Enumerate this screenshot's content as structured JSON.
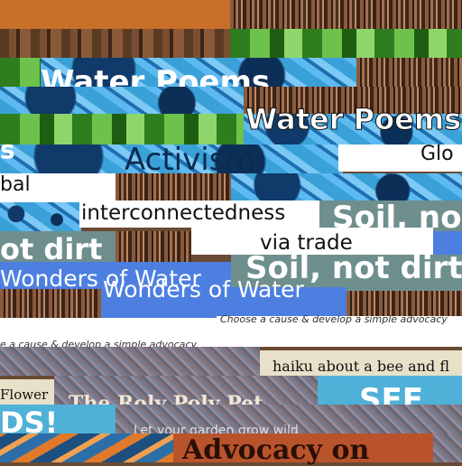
{
  "texts": {
    "water_poems_top": "Water Poems",
    "water_poems_right": "Water Poems",
    "activism": "Activism",
    "glo": "Glo",
    "bal": "bal",
    "s_left": "s",
    "interconnectedness": "interconnectedness",
    "via_trade": "via trade",
    "soil_top": "Soil, no",
    "soil_bottom": "Soil, not dirt",
    "ot_dirt": "ot dirt",
    "wonders_left": "Wonders of Water",
    "wonders_right": "Wonders of Water",
    "choose_cause_right": "Choose a cause & develop a simple advocacy",
    "choose_cause_left": "e a cause & develop a simple advocacy",
    "haiku": "haiku about a bee and fl",
    "flower": "Flower",
    "ds": "DS!",
    "roly_poly": "The Roly Poly Pet",
    "see": "SEE",
    "garden": "Let your garden grow wild",
    "advocacy_on": "Advocacy on"
  },
  "colors": {
    "teal": "#6f8f8e",
    "royal_blue": "#4d7fe0",
    "sky_blue": "#4fb0d8",
    "rust": "#b8532c"
  }
}
